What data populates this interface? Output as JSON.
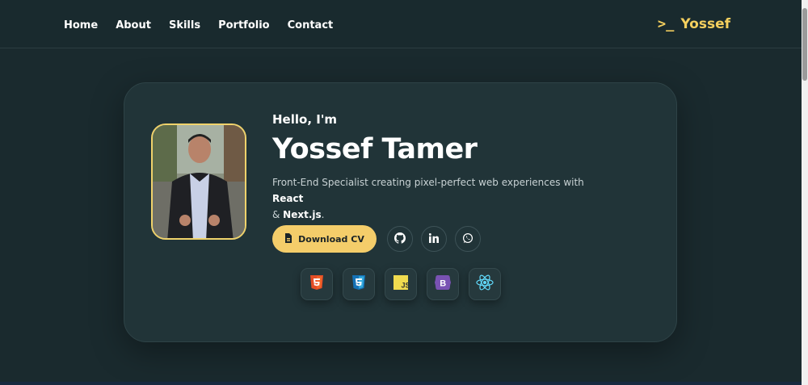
{
  "nav": {
    "items": [
      {
        "label": "Home"
      },
      {
        "label": "About"
      },
      {
        "label": "Skills"
      },
      {
        "label": "Portfolio"
      },
      {
        "label": "Contact"
      }
    ]
  },
  "logo": {
    "prompt": ">_",
    "text": "Yossef"
  },
  "hero": {
    "greeting": "Hello, I'm",
    "name": "Yossef Tamer",
    "description_prefix": "Front-End Specialist creating pixel-perfect web experiences with ",
    "tech_1": "React",
    "description_mid": " & ",
    "tech_2": "Next.js",
    "description_suffix": ".",
    "cv_button": "Download CV",
    "socials": [
      "github-icon",
      "linkedin-icon",
      "whatsapp-icon"
    ],
    "techs": [
      "html5-icon",
      "css3-icon",
      "javascript-icon",
      "bootstrap-icon",
      "react-icon"
    ]
  },
  "colors": {
    "background": "#1a2a2e",
    "card": "#213438",
    "accent": "#f4cd6a"
  }
}
